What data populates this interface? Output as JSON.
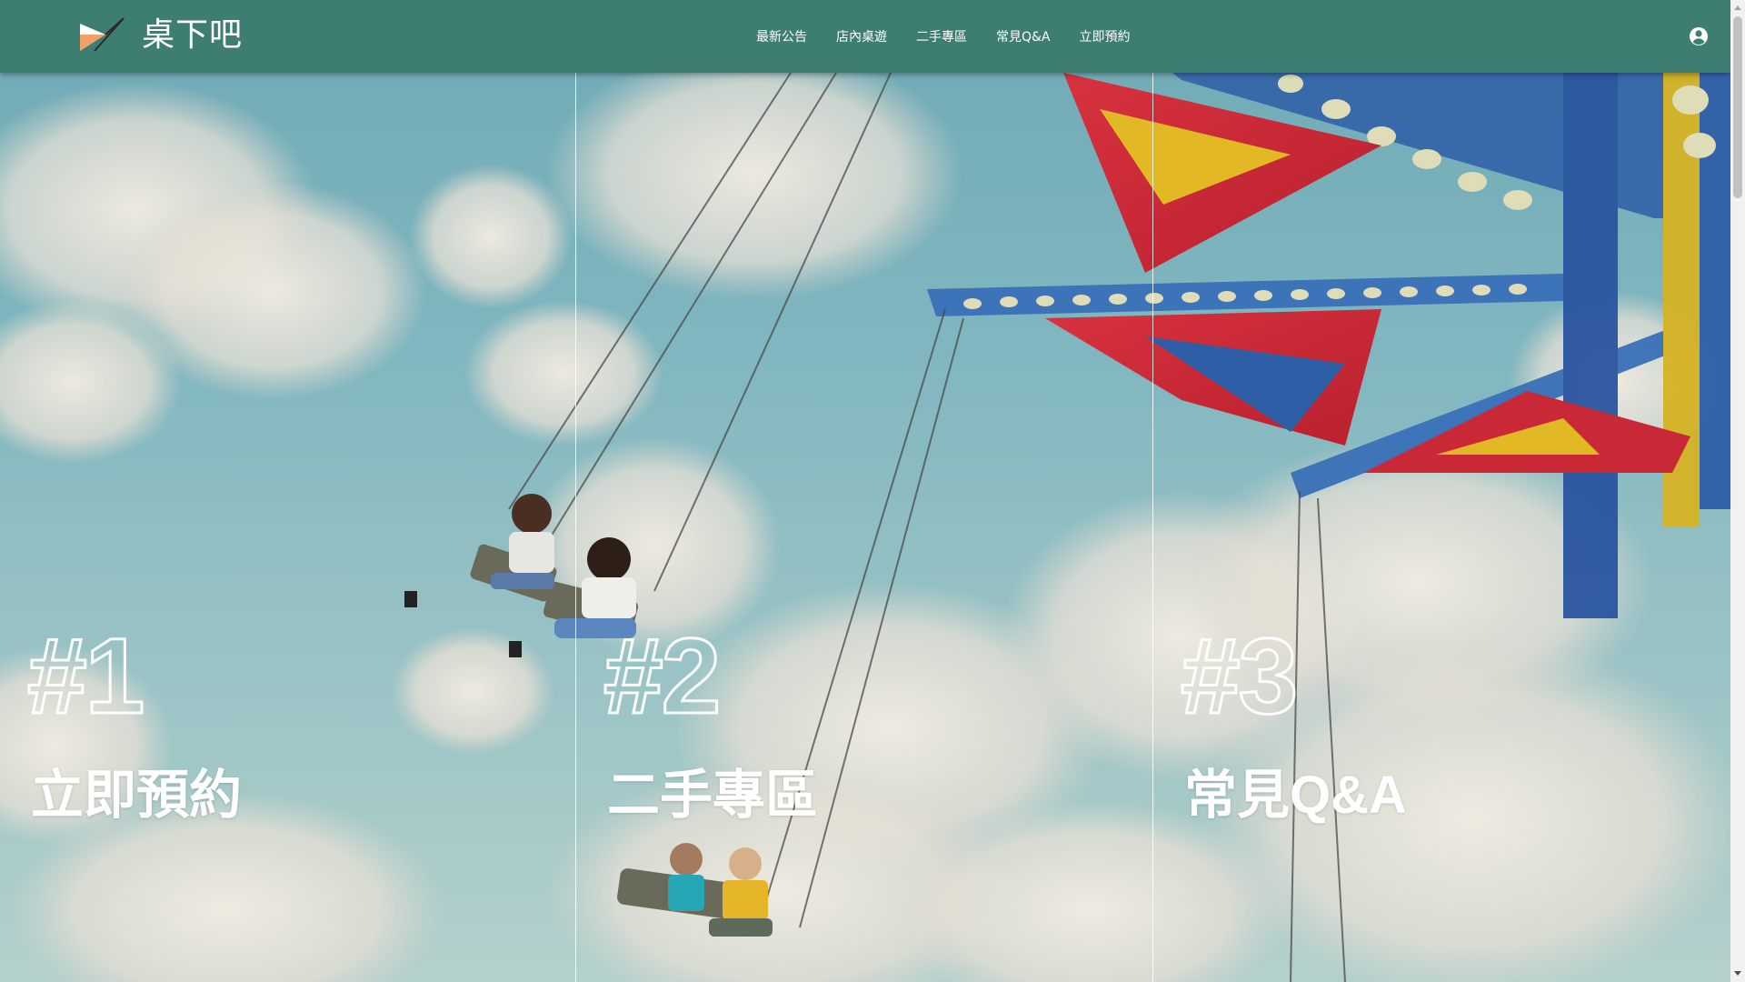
{
  "header": {
    "brand": "桌下吧",
    "nav": [
      "最新公告",
      "店內桌遊",
      "二手專區",
      "常見Q&A",
      "立即預約"
    ],
    "user_icon": "account-circle-icon"
  },
  "panels": [
    {
      "number": "#1",
      "title": "立即預約"
    },
    {
      "number": "#2",
      "title": "二手專區"
    },
    {
      "number": "#3",
      "title": "常見Q&A"
    }
  ],
  "colors": {
    "header_bg": "#3e7e72",
    "logo_orange": "#f2a06a",
    "text": "#ffffff",
    "sky": "#7fb5be"
  }
}
